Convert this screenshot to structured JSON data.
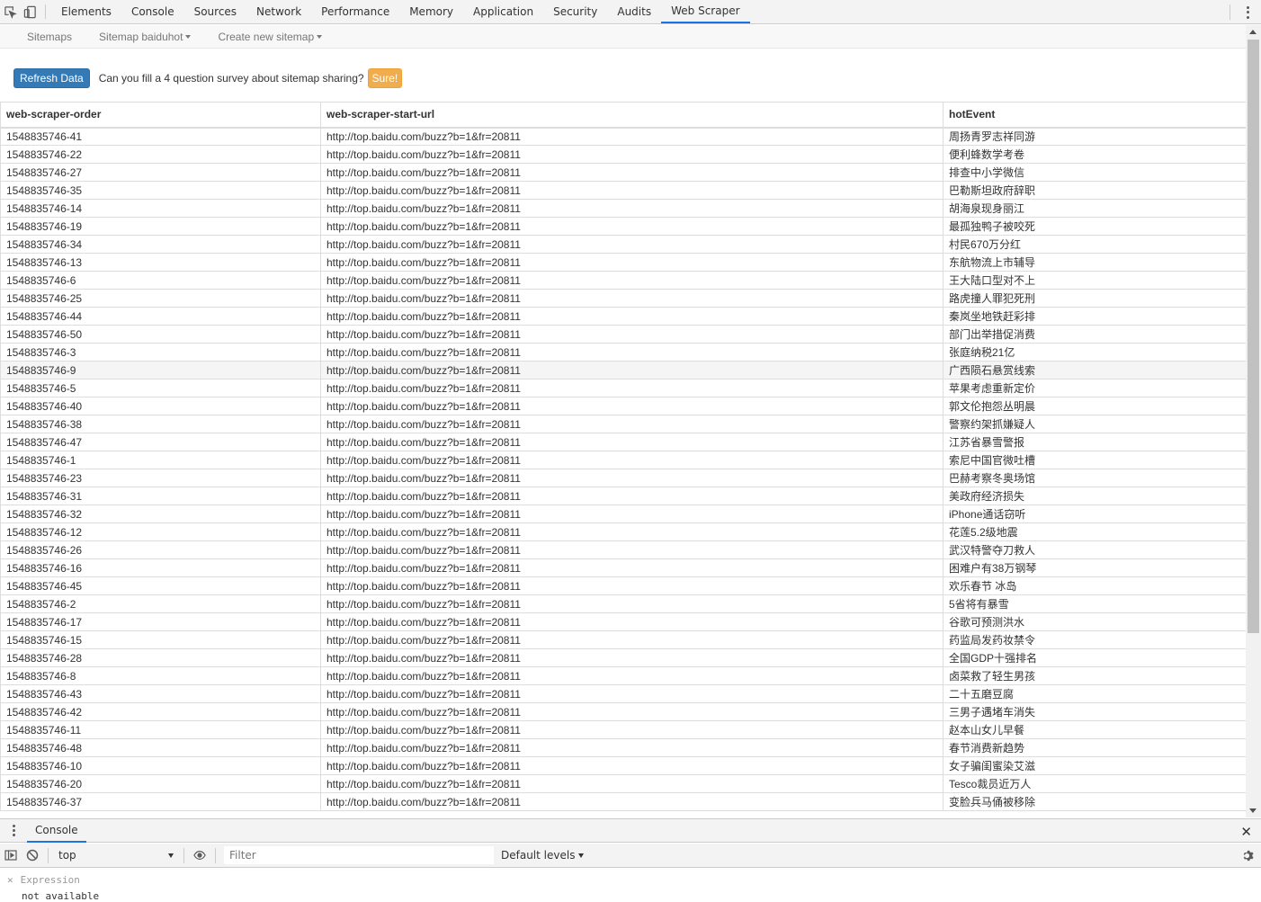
{
  "devtools": {
    "tabs": [
      "Elements",
      "Console",
      "Sources",
      "Network",
      "Performance",
      "Memory",
      "Application",
      "Security",
      "Audits",
      "Web Scraper"
    ],
    "active_tab": "Web Scraper"
  },
  "scraper_nav": {
    "sitemaps": "Sitemaps",
    "sitemap_menu": "Sitemap baiduhot",
    "create_menu": "Create new sitemap"
  },
  "toolbar": {
    "refresh_label": "Refresh Data",
    "survey_text": "Can you fill a 4 question survey about sitemap sharing?",
    "sure_label": "Sure!"
  },
  "table": {
    "headers": [
      "web-scraper-order",
      "web-scraper-start-url",
      "hotEvent"
    ],
    "highlighted_row": 13,
    "rows": [
      [
        "1548835746-41",
        "http://top.baidu.com/buzz?b=1&fr=20811",
        "周扬青罗志祥同游"
      ],
      [
        "1548835746-22",
        "http://top.baidu.com/buzz?b=1&fr=20811",
        "便利蜂数学考卷"
      ],
      [
        "1548835746-27",
        "http://top.baidu.com/buzz?b=1&fr=20811",
        "排查中小学微信"
      ],
      [
        "1548835746-35",
        "http://top.baidu.com/buzz?b=1&fr=20811",
        "巴勒斯坦政府辞职"
      ],
      [
        "1548835746-14",
        "http://top.baidu.com/buzz?b=1&fr=20811",
        "胡海泉现身丽江"
      ],
      [
        "1548835746-19",
        "http://top.baidu.com/buzz?b=1&fr=20811",
        "最孤独鸭子被咬死"
      ],
      [
        "1548835746-34",
        "http://top.baidu.com/buzz?b=1&fr=20811",
        "村民670万分红"
      ],
      [
        "1548835746-13",
        "http://top.baidu.com/buzz?b=1&fr=20811",
        "东航物流上市辅导"
      ],
      [
        "1548835746-6",
        "http://top.baidu.com/buzz?b=1&fr=20811",
        "王大陆口型对不上"
      ],
      [
        "1548835746-25",
        "http://top.baidu.com/buzz?b=1&fr=20811",
        "路虎撞人罪犯死刑"
      ],
      [
        "1548835746-44",
        "http://top.baidu.com/buzz?b=1&fr=20811",
        "秦岚坐地铁赶彩排"
      ],
      [
        "1548835746-50",
        "http://top.baidu.com/buzz?b=1&fr=20811",
        "部门出举措促消费"
      ],
      [
        "1548835746-3",
        "http://top.baidu.com/buzz?b=1&fr=20811",
        "张庭纳税21亿"
      ],
      [
        "1548835746-9",
        "http://top.baidu.com/buzz?b=1&fr=20811",
        "广西陨石悬赏线索"
      ],
      [
        "1548835746-5",
        "http://top.baidu.com/buzz?b=1&fr=20811",
        "苹果考虑重新定价"
      ],
      [
        "1548835746-40",
        "http://top.baidu.com/buzz?b=1&fr=20811",
        "郭文伦抱怨丛明晨"
      ],
      [
        "1548835746-38",
        "http://top.baidu.com/buzz?b=1&fr=20811",
        "警察约架抓嫌疑人"
      ],
      [
        "1548835746-47",
        "http://top.baidu.com/buzz?b=1&fr=20811",
        "江苏省暴雪警报"
      ],
      [
        "1548835746-1",
        "http://top.baidu.com/buzz?b=1&fr=20811",
        "索尼中国官微吐槽"
      ],
      [
        "1548835746-23",
        "http://top.baidu.com/buzz?b=1&fr=20811",
        "巴赫考察冬奥场馆"
      ],
      [
        "1548835746-31",
        "http://top.baidu.com/buzz?b=1&fr=20811",
        "美政府经济损失"
      ],
      [
        "1548835746-32",
        "http://top.baidu.com/buzz?b=1&fr=20811",
        "iPhone通话窃听"
      ],
      [
        "1548835746-12",
        "http://top.baidu.com/buzz?b=1&fr=20811",
        "花莲5.2级地震"
      ],
      [
        "1548835746-26",
        "http://top.baidu.com/buzz?b=1&fr=20811",
        "武汉特警夺刀救人"
      ],
      [
        "1548835746-16",
        "http://top.baidu.com/buzz?b=1&fr=20811",
        "困难户有38万钢琴"
      ],
      [
        "1548835746-45",
        "http://top.baidu.com/buzz?b=1&fr=20811",
        "欢乐春节 冰岛"
      ],
      [
        "1548835746-2",
        "http://top.baidu.com/buzz?b=1&fr=20811",
        "5省将有暴雪"
      ],
      [
        "1548835746-17",
        "http://top.baidu.com/buzz?b=1&fr=20811",
        "谷歌可预测洪水"
      ],
      [
        "1548835746-15",
        "http://top.baidu.com/buzz?b=1&fr=20811",
        "药监局发药妆禁令"
      ],
      [
        "1548835746-28",
        "http://top.baidu.com/buzz?b=1&fr=20811",
        "全国GDP十强排名"
      ],
      [
        "1548835746-8",
        "http://top.baidu.com/buzz?b=1&fr=20811",
        "卤菜救了轻生男孩"
      ],
      [
        "1548835746-43",
        "http://top.baidu.com/buzz?b=1&fr=20811",
        "二十五磨豆腐"
      ],
      [
        "1548835746-42",
        "http://top.baidu.com/buzz?b=1&fr=20811",
        "三男子遇堵车消失"
      ],
      [
        "1548835746-11",
        "http://top.baidu.com/buzz?b=1&fr=20811",
        "赵本山女儿早餐"
      ],
      [
        "1548835746-48",
        "http://top.baidu.com/buzz?b=1&fr=20811",
        "春节消费新趋势"
      ],
      [
        "1548835746-10",
        "http://top.baidu.com/buzz?b=1&fr=20811",
        "女子骗闺蜜染艾滋"
      ],
      [
        "1548835746-20",
        "http://top.baidu.com/buzz?b=1&fr=20811",
        "Tesco裁员近万人"
      ],
      [
        "1548835746-37",
        "http://top.baidu.com/buzz?b=1&fr=20811",
        "变脸兵马俑被移除"
      ]
    ]
  },
  "drawer": {
    "tab": "Console"
  },
  "console_toolbar": {
    "context": "top",
    "filter_placeholder": "Filter",
    "levels": "Default levels"
  },
  "console_body": {
    "expression_label": "Expression",
    "expression_value": "not available"
  },
  "icons": {
    "inspect": "inspect-element-icon",
    "device": "device-toggle-icon",
    "menu": "more-vert-icon",
    "close": "close-icon",
    "sidebar": "console-sidebar-icon",
    "clear": "clear-console-icon",
    "eye": "live-expression-icon",
    "gear": "gear-icon"
  },
  "colors": {
    "accent": "#1a73e8",
    "refresh_btn": "#337ab7",
    "sure_btn": "#f0ad4e"
  }
}
